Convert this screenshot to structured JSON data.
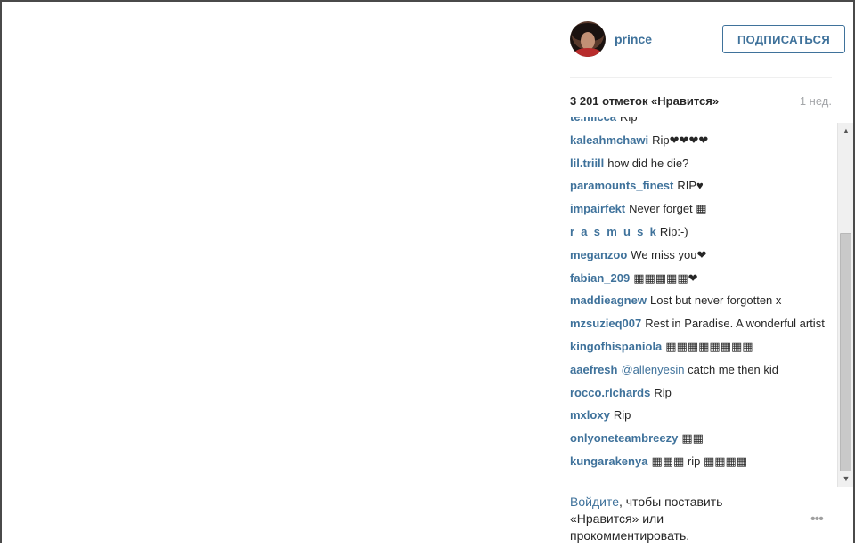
{
  "post": {
    "username": "prince",
    "follow_label": "ПОДПИСАТЬСЯ",
    "likes": "3 201 отметок «Нравится»",
    "time": "1 нед."
  },
  "comments": [
    {
      "user": "te.micca",
      "text": "Rip"
    },
    {
      "user": "kaleahmchawi",
      "text": "Rip❤❤❤❤"
    },
    {
      "user": "lil.triill",
      "text": "how did he die?"
    },
    {
      "user": "paramounts_finest",
      "text": "RIP♥"
    },
    {
      "user": "impairfekt",
      "text": "Never forget ▦"
    },
    {
      "user": "r_a_s_m_u_s_k",
      "text": "Rip:-)"
    },
    {
      "user": "meganzoo",
      "text": "We miss you❤"
    },
    {
      "user": "fabian_209",
      "text": "▦▦▦▦▦❤"
    },
    {
      "user": "maddieagnew",
      "text": "Lost but never forgotten x"
    },
    {
      "user": "mzsuzieq007",
      "text": "Rest in Paradise. A wonderful artist"
    },
    {
      "user": "kingofhispaniola",
      "text": "▦▦▦▦▦▦▦▦"
    },
    {
      "user": "aaefresh",
      "mention": "@allenyesin",
      "text": "catch me then kid"
    },
    {
      "user": "rocco.richards",
      "text": "Rip"
    },
    {
      "user": "mxloxy",
      "text": "Rip"
    },
    {
      "user": "onlyoneteambreezy",
      "text": "▦▦"
    },
    {
      "user": "kungarakenya",
      "text": "▦▦▦ rip ▦▦▦▦"
    }
  ],
  "footer": {
    "login_link": "Войдите",
    "login_rest": ", чтобы поставить «Нравится» или прокомментировать.",
    "more_icon": "•••"
  },
  "scrollbar": {
    "up_icon": "▲",
    "down_icon": "▼"
  },
  "colors": {
    "link": "#3f729b",
    "text": "#262626",
    "muted": "#a5a7aa"
  }
}
